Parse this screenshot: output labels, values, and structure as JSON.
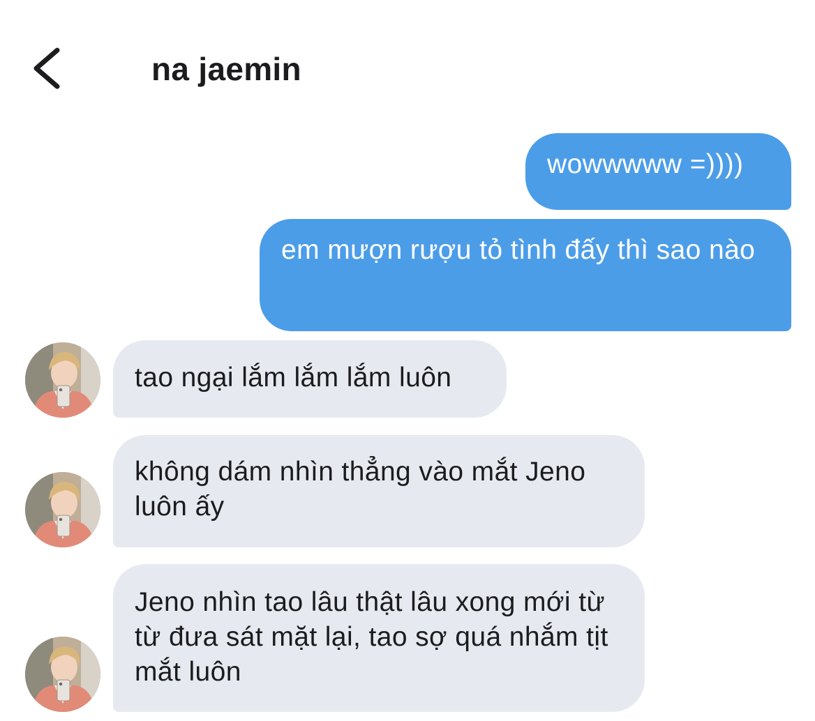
{
  "header": {
    "back_icon": "chevron-left-icon",
    "title": "na jaemin"
  },
  "colors": {
    "outgoing_bubble": "#4c9de8",
    "incoming_bubble": "#e6eaf0",
    "text_dark": "#1c1c1e"
  },
  "messages": [
    {
      "sender": "me",
      "text": "wowwwww =))))"
    },
    {
      "sender": "me",
      "text": "em mượn rượu tỏ tình đấy thì sao nào"
    },
    {
      "sender": "contact",
      "text": "tao ngại lắm lắm lắm luôn"
    },
    {
      "sender": "contact",
      "text": "không dám nhìn thẳng vào mắt Jeno luôn ấy"
    },
    {
      "sender": "contact",
      "text": "Jeno nhìn tao lâu thật lâu xong mới từ từ đưa sát mặt lại, tao sợ quá nhắm tịt mắt luôn"
    }
  ]
}
